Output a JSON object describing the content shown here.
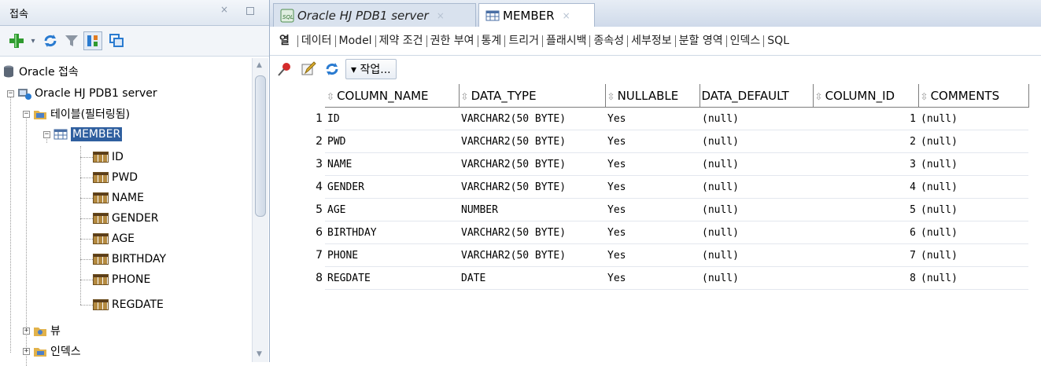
{
  "left_panel": {
    "title": "접속",
    "close_glyph": "×",
    "tree": {
      "root": "Oracle 접속",
      "connection": "Oracle HJ PDB1 server",
      "tables_folder": "테이블(필터링됨)",
      "selected_table": "MEMBER",
      "columns": [
        "ID",
        "PWD",
        "NAME",
        "GENDER",
        "AGE",
        "BIRTHDAY",
        "PHONE",
        "REGDATE"
      ],
      "views_folder": "뷰",
      "indexes_folder": "인덱스"
    }
  },
  "editor": {
    "tabs": [
      {
        "label": "Oracle HJ PDB1 server",
        "icon": "sql-worksheet-icon",
        "active": false
      },
      {
        "label": "MEMBER",
        "icon": "table-icon",
        "active": true
      }
    ],
    "tab_close_glyph": "×",
    "subtabs": [
      "열",
      "데이터",
      "Model",
      "제약 조건",
      "권한 부여",
      "통계",
      "트리거",
      "플래시백",
      "종속성",
      "세부정보",
      "분할 영역",
      "인덱스",
      "SQL"
    ],
    "action_label": "▾ 작업..."
  },
  "grid": {
    "headers": [
      "COLUMN_NAME",
      "DATA_TYPE",
      "NULLABLE",
      "DATA_DEFAULT",
      "COLUMN_ID",
      "COMMENTS"
    ],
    "rows": [
      {
        "n": "1",
        "name": "ID",
        "type": "VARCHAR2(50 BYTE)",
        "nullable": "Yes",
        "default": "(null)",
        "id": "1",
        "comments": "(null)"
      },
      {
        "n": "2",
        "name": "PWD",
        "type": "VARCHAR2(50 BYTE)",
        "nullable": "Yes",
        "default": "(null)",
        "id": "2",
        "comments": "(null)"
      },
      {
        "n": "3",
        "name": "NAME",
        "type": "VARCHAR2(50 BYTE)",
        "nullable": "Yes",
        "default": "(null)",
        "id": "3",
        "comments": "(null)"
      },
      {
        "n": "4",
        "name": "GENDER",
        "type": "VARCHAR2(50 BYTE)",
        "nullable": "Yes",
        "default": "(null)",
        "id": "4",
        "comments": "(null)"
      },
      {
        "n": "5",
        "name": "AGE",
        "type": "NUMBER",
        "nullable": "Yes",
        "default": "(null)",
        "id": "5",
        "comments": "(null)"
      },
      {
        "n": "6",
        "name": "BIRTHDAY",
        "type": "VARCHAR2(50 BYTE)",
        "nullable": "Yes",
        "default": "(null)",
        "id": "6",
        "comments": "(null)"
      },
      {
        "n": "7",
        "name": "PHONE",
        "type": "VARCHAR2(50 BYTE)",
        "nullable": "Yes",
        "default": "(null)",
        "id": "7",
        "comments": "(null)"
      },
      {
        "n": "8",
        "name": "REGDATE",
        "type": "DATE",
        "nullable": "Yes",
        "default": "(null)",
        "id": "8",
        "comments": "(null)"
      }
    ]
  },
  "colors": {
    "selection": "#2f5f9f",
    "panel_border": "#9fb1c8",
    "tab_bar": "#cfdaea"
  },
  "icons": [
    "add-connection-icon",
    "refresh-icon",
    "filter-icon",
    "schema-browser-icon",
    "copy-icon",
    "pin-icon",
    "edit-icon",
    "refresh-icon",
    "database-icon",
    "connection-icon",
    "folder-icon",
    "table-icon",
    "column-icon",
    "view-folder-icon",
    "index-folder-icon",
    "sort-icon"
  ]
}
